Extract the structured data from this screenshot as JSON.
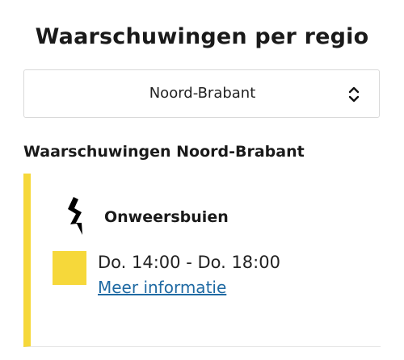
{
  "page": {
    "title": "Waarschuwingen per regio"
  },
  "region_select": {
    "selected": "Noord-Brabant",
    "icon": "chevron-up-down-icon"
  },
  "section": {
    "title": "Waarschuwingen Noord-Brabant"
  },
  "warning": {
    "icon": "lightning-bolt-icon",
    "type": "Onweersbuien",
    "level_color": "#f6d83a",
    "time_range": "Do. 14:00 - Do. 18:00",
    "link_label": "Meer informatie"
  },
  "colors": {
    "accent_yellow": "#f6d83a",
    "link_blue": "#1f6aa3"
  }
}
